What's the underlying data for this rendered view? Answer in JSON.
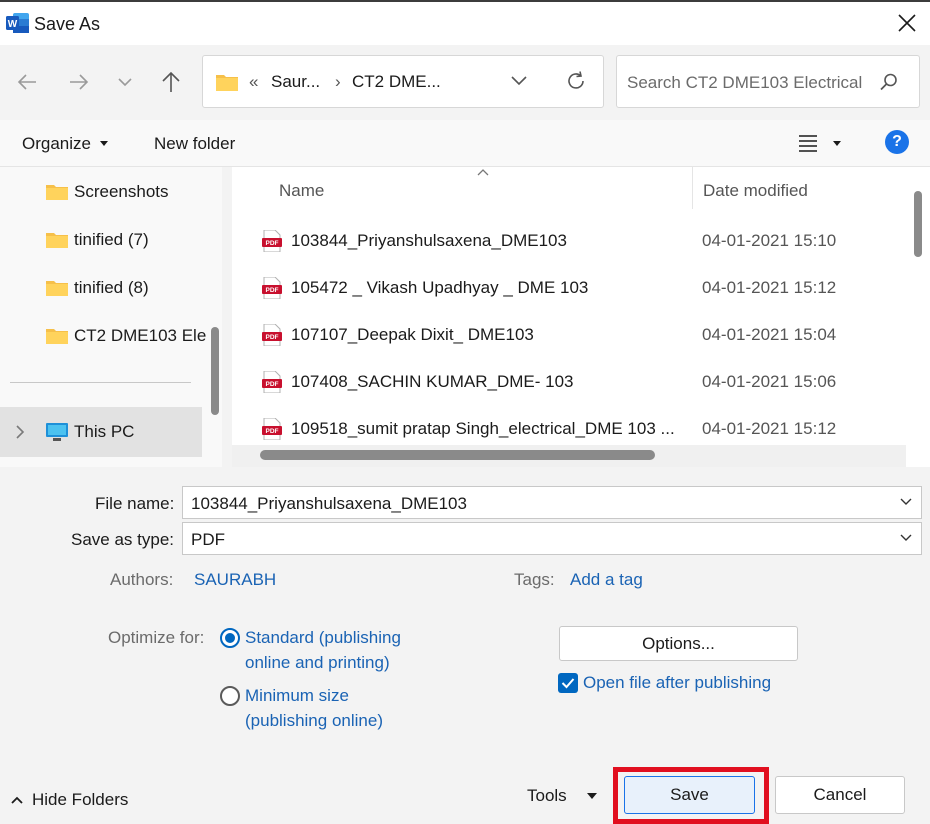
{
  "window": {
    "title": "Save As",
    "close": "✕"
  },
  "nav": {
    "back": "←",
    "forward": "→",
    "recent": "⌄",
    "up": "↑",
    "address": {
      "sep1": "«",
      "crumb1": "Saur...",
      "sep2": "›",
      "crumb2": "CT2 DME..."
    },
    "search_placeholder": "Search CT2 DME103 Electrical"
  },
  "toolbar": {
    "organize": "Organize",
    "new_folder": "New folder",
    "help": "?"
  },
  "tree": {
    "items": [
      {
        "label": "Screenshots"
      },
      {
        "label": "tinified (7)"
      },
      {
        "label": "tinified (8)"
      },
      {
        "label": "CT2 DME103 Ele"
      }
    ],
    "this_pc": "This PC"
  },
  "files": {
    "columns": {
      "name": "Name",
      "date": "Date modified"
    },
    "rows": [
      {
        "name": "103844_Priyanshulsaxena_DME103",
        "date": "04-01-2021 15:10",
        "icon": "PDF"
      },
      {
        "name": "105472 _ Vikash Upadhyay _ DME 103",
        "date": "04-01-2021 15:12",
        "icon": "PDF"
      },
      {
        "name": "107107_Deepak Dixit_ DME103",
        "date": "04-01-2021 15:04",
        "icon": "PDF"
      },
      {
        "name": "107408_SACHIN KUMAR_DME- 103",
        "date": "04-01-2021 15:06",
        "icon": "PDF"
      },
      {
        "name": "109518_sumit pratap Singh_electrical_DME 103 ...",
        "date": "04-01-2021 15:12",
        "icon": "PDF"
      }
    ]
  },
  "form": {
    "file_name_label": "File name:",
    "file_name_value": "103844_Priyanshulsaxena_DME103",
    "type_label": "Save as type:",
    "type_value": "PDF",
    "authors_label": "Authors:",
    "authors_value": "SAURABH",
    "tags_label": "Tags:",
    "tags_value": "Add a tag",
    "optimize_label": "Optimize for:",
    "opt_standard_1": "Standard (publishing",
    "opt_standard_2": "online and printing)",
    "opt_min_1": "Minimum size",
    "opt_min_2": "(publishing online)",
    "options_button": "Options...",
    "open_after": "Open file after publishing"
  },
  "footer": {
    "hide_folders": "Hide Folders",
    "tools": "Tools",
    "save": "Save",
    "cancel": "Cancel"
  },
  "colors": {
    "accent": "#0067c0",
    "link": "#1a63b4",
    "highlight": "#e10f1f",
    "pdf": "#c8102e"
  }
}
